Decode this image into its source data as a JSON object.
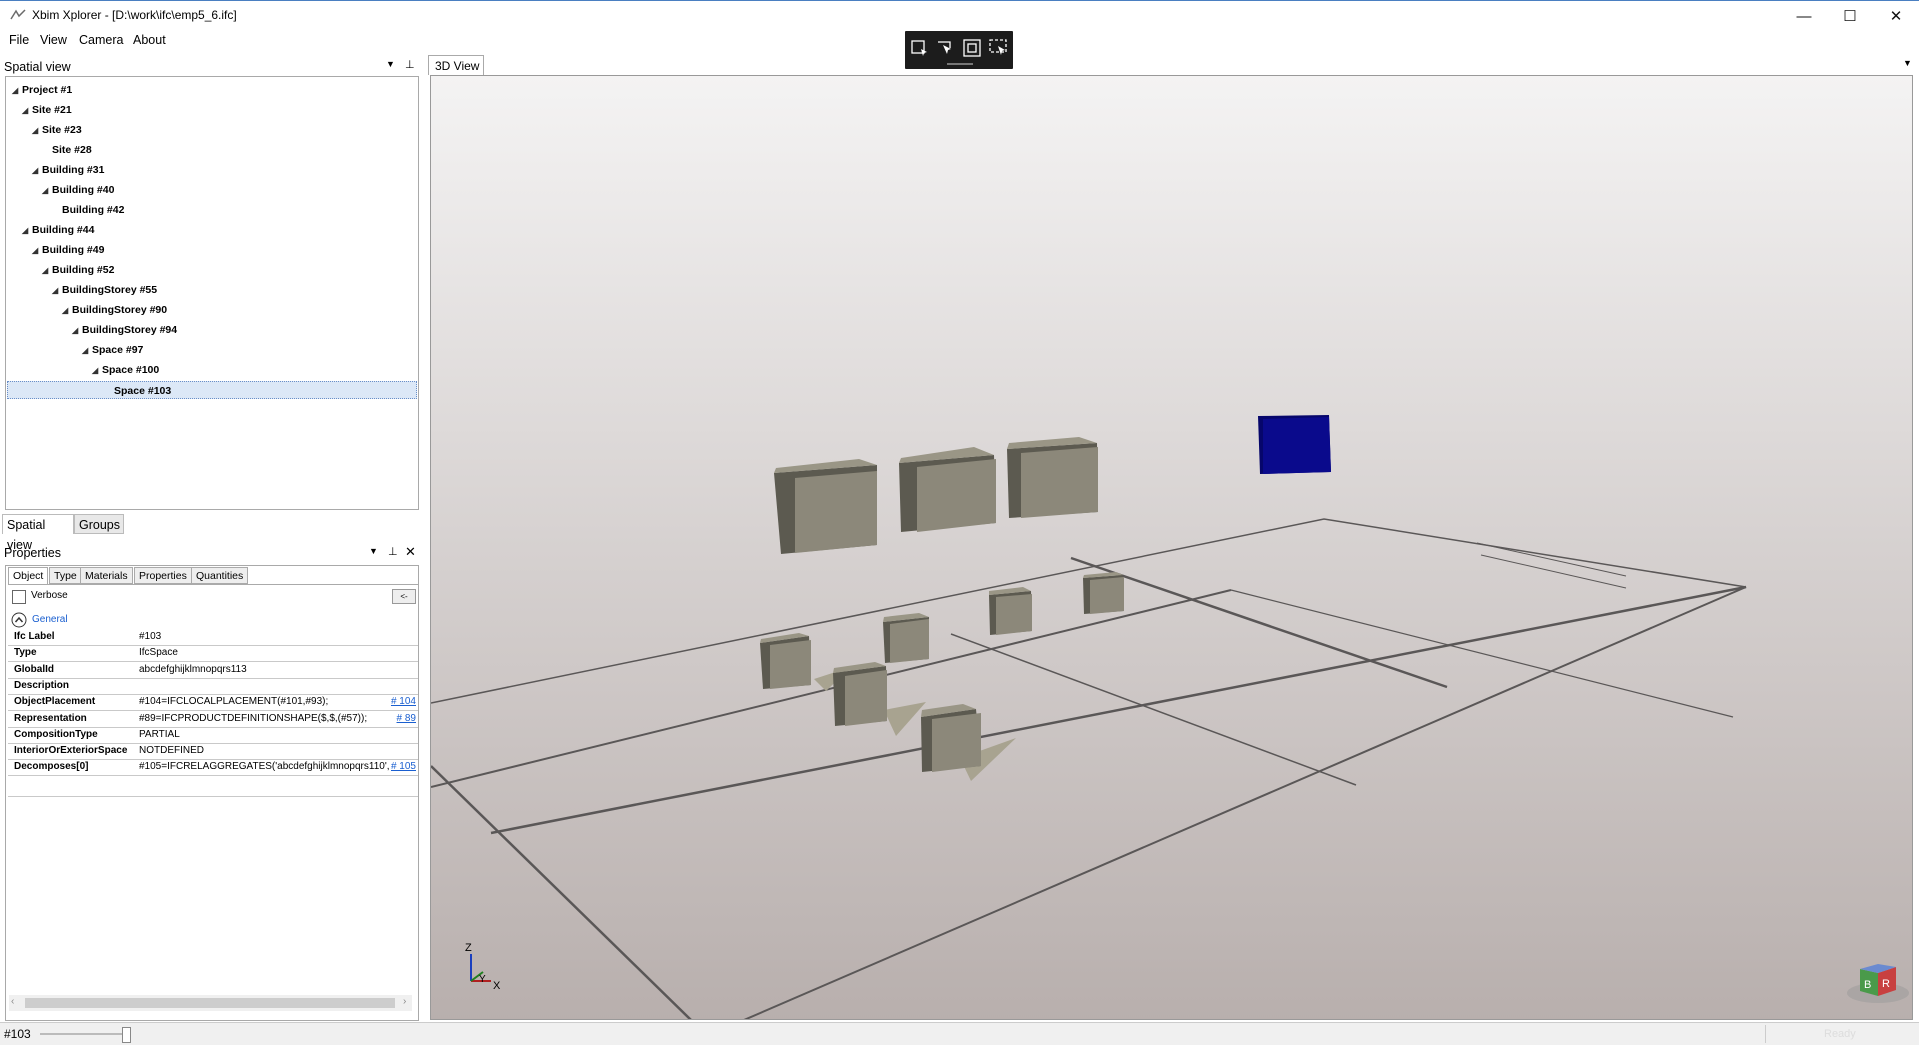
{
  "window": {
    "title": "Xbim Xplorer - [D:\\work\\ifc\\emp5_6.ifc]",
    "minimize": "—",
    "maximize": "☐",
    "close": "✕"
  },
  "menu": [
    "File",
    "View",
    "Camera",
    "About"
  ],
  "spatial_panel": {
    "title": "Spatial view",
    "tree": [
      {
        "label": "Project #1",
        "level": 0,
        "expanded": true
      },
      {
        "label": "Site #21",
        "level": 1,
        "expanded": true
      },
      {
        "label": "Site #23",
        "level": 2,
        "expanded": true
      },
      {
        "label": "Site #28",
        "level": 3,
        "expanded": false
      },
      {
        "label": "Building #31",
        "level": 2,
        "expanded": true
      },
      {
        "label": "Building #40",
        "level": 3,
        "expanded": true
      },
      {
        "label": "Building #42",
        "level": 4,
        "expanded": false
      },
      {
        "label": "Building #44",
        "level": 1,
        "expanded": true
      },
      {
        "label": "Building #49",
        "level": 2,
        "expanded": true
      },
      {
        "label": "Building #52",
        "level": 3,
        "expanded": true
      },
      {
        "label": "BuildingStorey #55",
        "level": 4,
        "expanded": true
      },
      {
        "label": "BuildingStorey #90",
        "level": 5,
        "expanded": true
      },
      {
        "label": "BuildingStorey #94",
        "level": 6,
        "expanded": true
      },
      {
        "label": "Space #97",
        "level": 7,
        "expanded": true
      },
      {
        "label": "Space #100",
        "level": 8,
        "expanded": true
      },
      {
        "label": "Space #103",
        "level": 9,
        "expanded": false,
        "selected": true
      }
    ],
    "tabs": [
      "Spatial view",
      "Groups"
    ]
  },
  "properties_panel": {
    "title": "Properties",
    "tabs": [
      "Object",
      "Type",
      "Materials",
      "Properties",
      "Quantities"
    ],
    "verbose_label": "Verbose",
    "verbose_checked": false,
    "collapse_btn": "<-",
    "section": "General",
    "rows": [
      {
        "key": "Ifc Label",
        "value": "#103",
        "link": ""
      },
      {
        "key": "Type",
        "value": "IfcSpace",
        "link": ""
      },
      {
        "key": "GlobalId",
        "value": "abcdefghijklmnopqrs113",
        "link": ""
      },
      {
        "key": "Description",
        "value": "",
        "link": ""
      },
      {
        "key": "ObjectPlacement",
        "value": "#104=IFCLOCALPLACEMENT(#101,#93);",
        "link": "# 104"
      },
      {
        "key": "Representation",
        "value": "#89=IFCPRODUCTDEFINITIONSHAPE($,$,(#57));",
        "link": "# 89"
      },
      {
        "key": "CompositionType",
        "value": "PARTIAL",
        "link": ""
      },
      {
        "key": "InteriorOrExteriorSpace",
        "value": "NOTDEFINED",
        "link": ""
      },
      {
        "key": "Decomposes[0]",
        "value": "#105=IFCRELAGGREGATES('abcdefghijklmnopqrs110',$,",
        "link": "# 105"
      }
    ]
  },
  "view3d": {
    "tab": "3D View",
    "axis_labels": {
      "z": "Z",
      "y": "Y",
      "x": "X"
    },
    "cube_labels": {
      "b": "B",
      "r": "R"
    },
    "colors": {
      "box": "#8c887a",
      "selected": "#0a0a8c",
      "bg_top": "#f4f3f3",
      "bg_bottom": "#b8afad"
    }
  },
  "status": {
    "selection": "#103",
    "state": "Ready",
    "slider": 0.95
  }
}
